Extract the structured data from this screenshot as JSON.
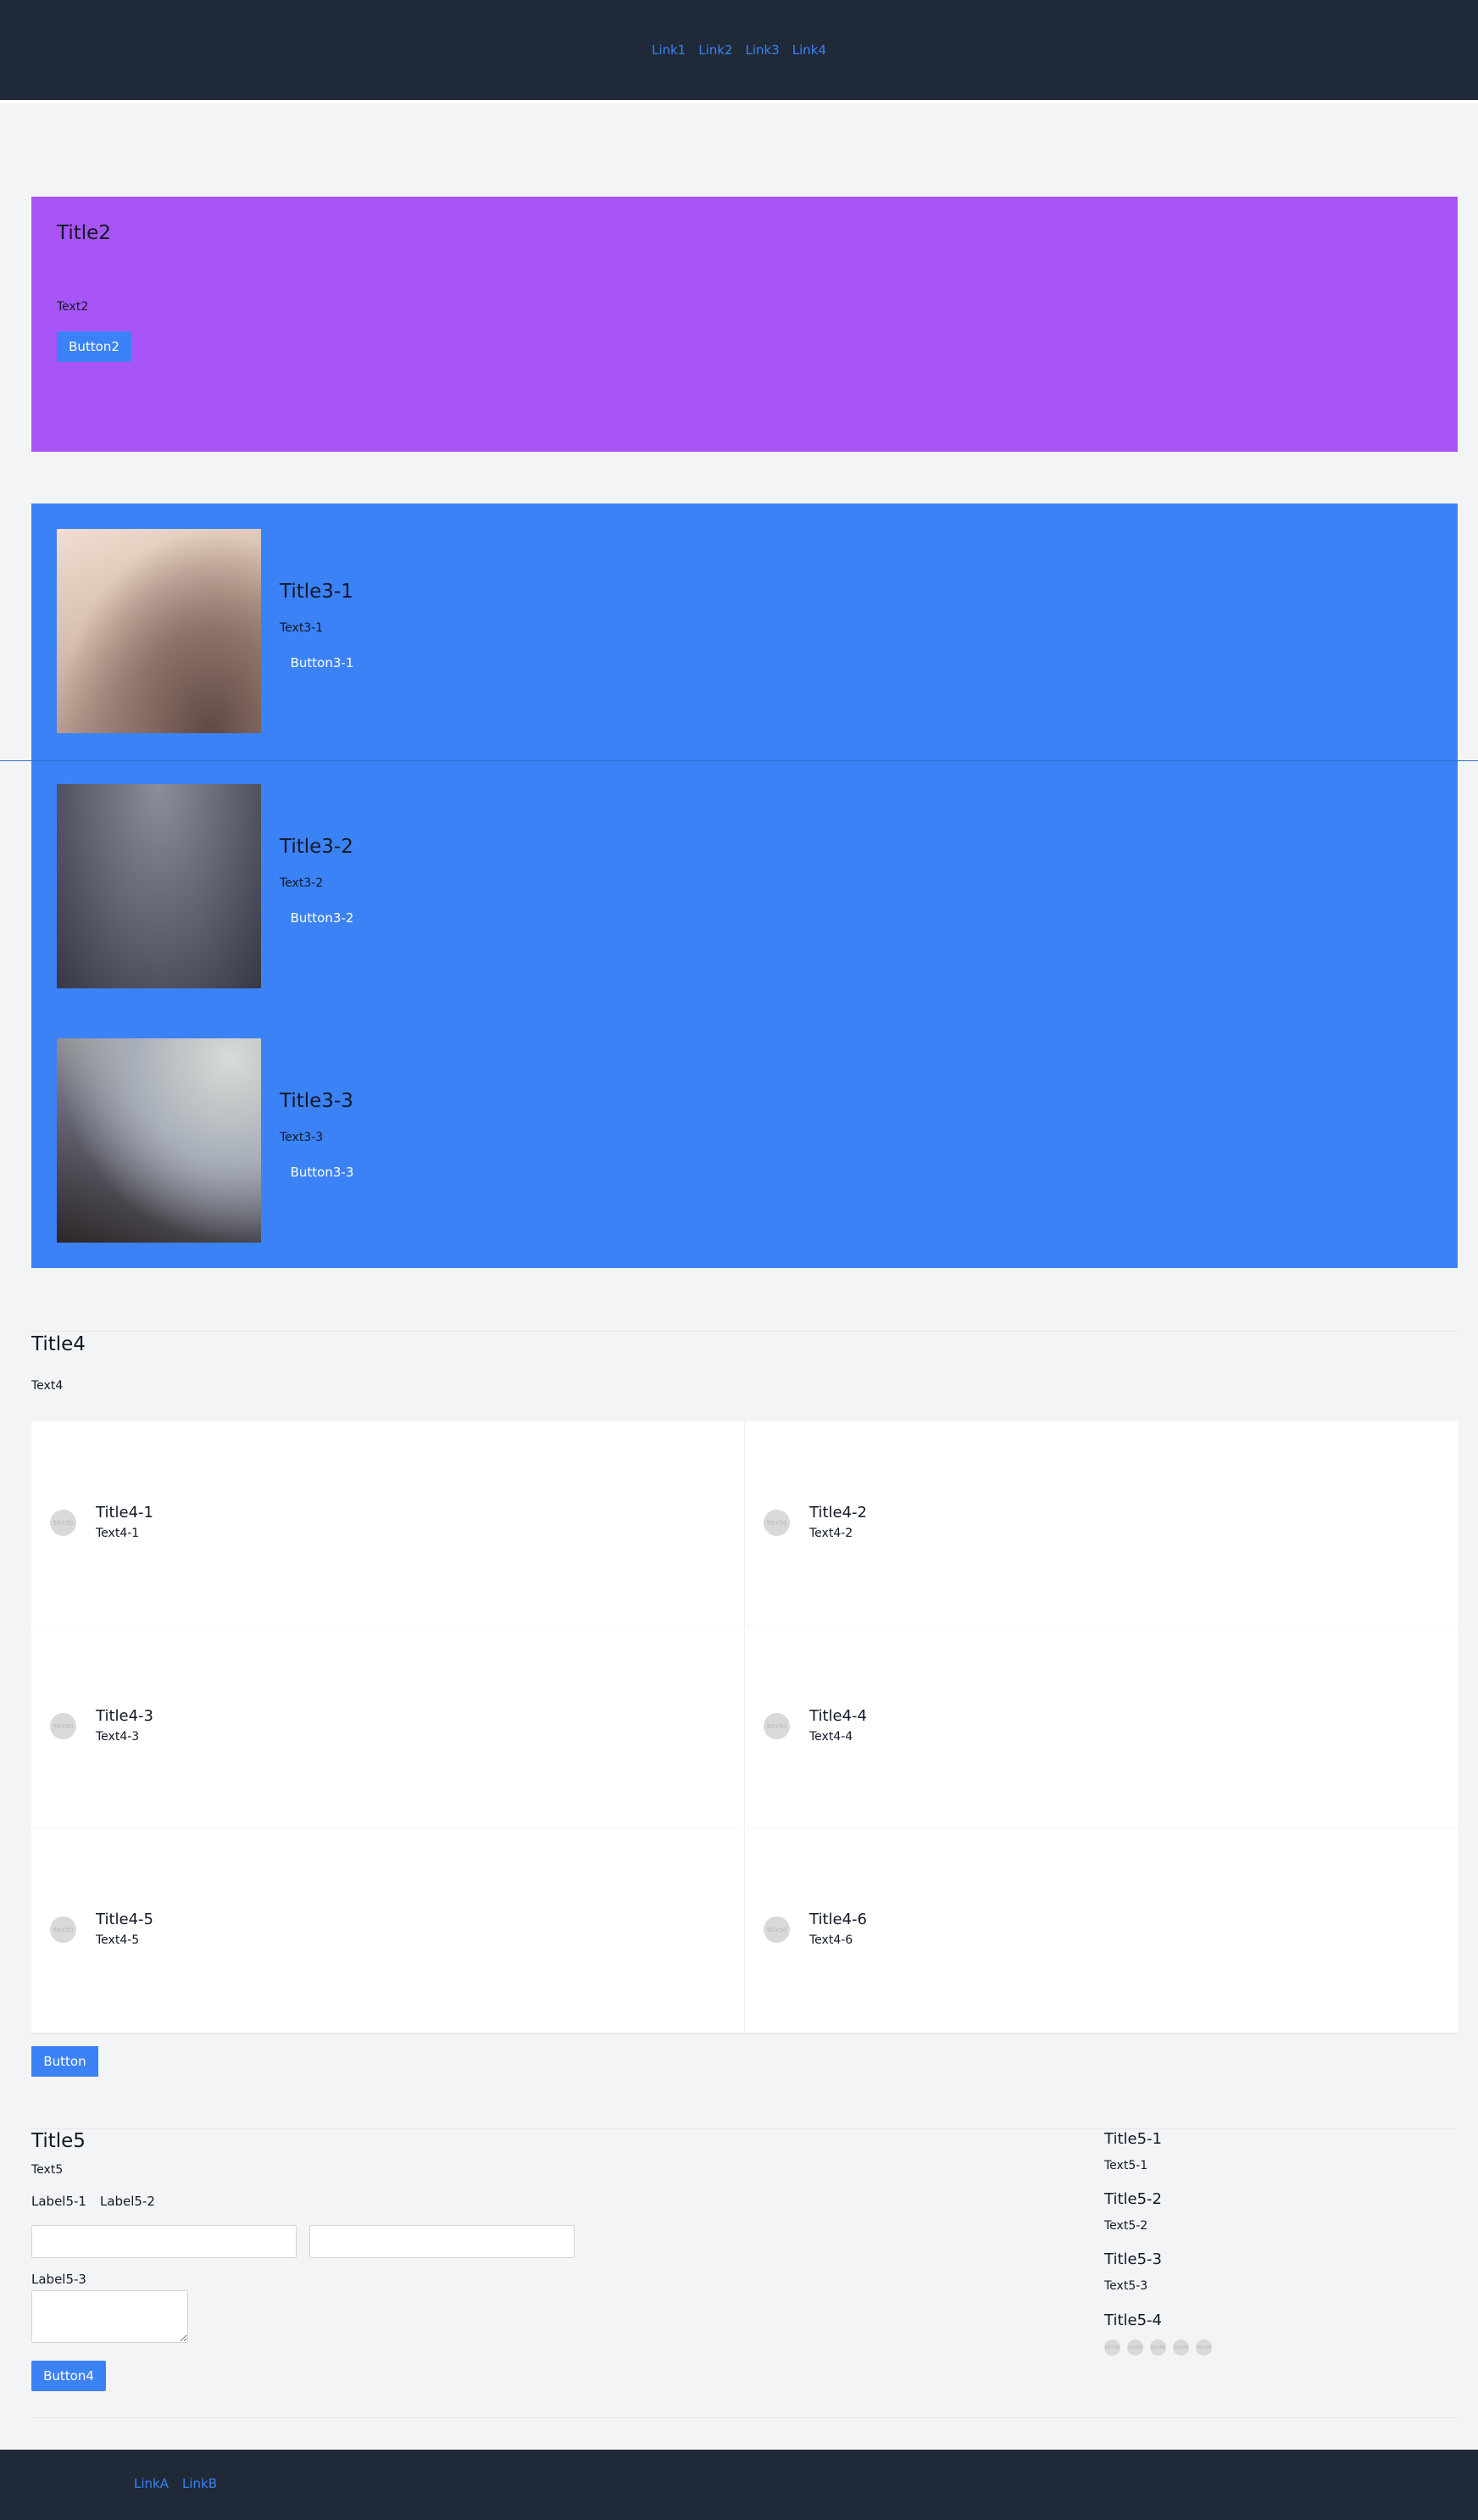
{
  "header": {
    "links": [
      "Link1",
      "Link2",
      "Link3",
      "Link4"
    ]
  },
  "hero": {
    "title": "Title2",
    "text": "Text2",
    "button": "Button2"
  },
  "features": [
    {
      "title": "Title3-1",
      "text": "Text3-1",
      "button": "Button3-1"
    },
    {
      "title": "Title3-2",
      "text": "Text3-2",
      "button": "Button3-2"
    },
    {
      "title": "Title3-3",
      "text": "Text3-3",
      "button": "Button3-3"
    }
  ],
  "section4": {
    "title": "Title4",
    "text": "Text4",
    "items": [
      {
        "title": "Title4-1",
        "text": "Text4-1"
      },
      {
        "title": "Title4-2",
        "text": "Text4-2"
      },
      {
        "title": "Title4-3",
        "text": "Text4-3"
      },
      {
        "title": "Title4-4",
        "text": "Text4-4"
      },
      {
        "title": "Title4-5",
        "text": "Text4-5"
      },
      {
        "title": "Title4-6",
        "text": "Text4-6"
      }
    ],
    "button": "Button"
  },
  "section5": {
    "title": "Title5",
    "text": "Text5",
    "label1": "Label5-1",
    "label2": "Label5-2",
    "label3": "Label5-3",
    "button": "Button4",
    "side": [
      {
        "title": "Title5-1",
        "text": "Text5-1"
      },
      {
        "title": "Title5-2",
        "text": "Text5-2"
      },
      {
        "title": "Title5-3",
        "text": "Text5-3"
      },
      {
        "title": "Title5-4"
      }
    ]
  },
  "footer": {
    "links": [
      "LinkA",
      "LinkB"
    ]
  },
  "colors": {
    "header_bg": "#1f2937",
    "hero_bg": "#a855f7",
    "feature_bg": "#3b82f6",
    "link": "#3b82f6",
    "button": "#3b82f6",
    "page_bg": "#f3f4f6"
  }
}
